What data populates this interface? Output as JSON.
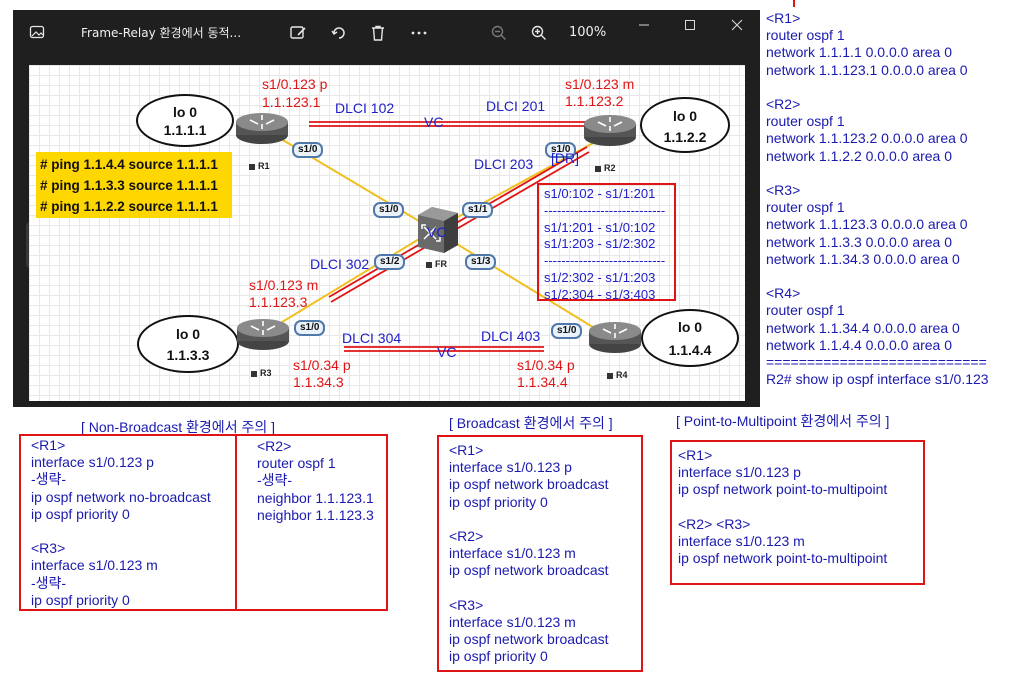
{
  "viewer": {
    "title": "Frame-Relay 환경에서 동적...",
    "zoom": "100%",
    "icons": [
      "photo-app-icon",
      "edit-image-icon",
      "rotate-icon",
      "delete-icon",
      "more-icon",
      "zoom-out-icon",
      "zoom-in-icon",
      "minimize-icon",
      "maximize-icon",
      "close-icon"
    ]
  },
  "diagram": {
    "routers": [
      {
        "name": "R1"
      },
      {
        "name": "R2"
      },
      {
        "name": "R3"
      },
      {
        "name": "R4"
      },
      {
        "name": "FR"
      }
    ],
    "loopbacks": [
      {
        "l1": "lo 0",
        "l2": "1.1.1.1"
      },
      {
        "l1": "lo 0",
        "l2": "1.1.2.2"
      },
      {
        "l1": "lo 0",
        "l2": "1.1.3.3"
      },
      {
        "l1": "lo 0",
        "l2": "1.1.4.4"
      }
    ],
    "interfaces": {
      "r1": "s1/0",
      "r2": "s1/0",
      "r3": "s1/0",
      "r4": "s1/0",
      "fr0": "s1/0",
      "fr1": "s1/1",
      "fr2": "s1/2",
      "fr3": "s1/3"
    },
    "red_labels": {
      "r1_if": "s1/0.123 p",
      "r1_ip": "1.1.123.1",
      "r2_if": "s1/0.123 m",
      "r2_ip": "1.1.123.2",
      "r3_if": "s1/0.123 m",
      "r3_ip": "1.1.123.3",
      "r3_if34": "s1/0.34 p",
      "r3_ip34": "1.1.34.3",
      "r4_if34": "s1/0.34 p",
      "r4_ip34": "1.1.34.4"
    },
    "blue_labels": {
      "dlci102": "DLCI 102",
      "dlci201": "DLCI 201",
      "dlci203": "DLCI 203",
      "dlci302": "DLCI 302",
      "dlci304": "DLCI 304",
      "dlci403": "DLCI 403",
      "vc_top": "VC",
      "vc_center": "VC",
      "vc_bottom": "VC",
      "dr": "[DR]"
    },
    "ping_lines": [
      "# ping 1.1.4.4 source 1.1.1.1",
      "# ping 1.1.3.3 source 1.1.1.1",
      "# ping 1.1.2.2 source 1.1.1.1"
    ],
    "mapping_lines": [
      "s1/0:102 - s1/1:201",
      "----------------------------",
      "s1/1:201 - s1/0:102",
      "s1/1:203 - s1/2:302",
      "----------------------------",
      "s1/2:302 - s1/1:203",
      "s1/2:304 - s1/3:403"
    ]
  },
  "right_config": [
    "<R1>",
    "router ospf 1",
    "network 1.1.1.1 0.0.0.0 area 0",
    "network 1.1.123.1 0.0.0.0 area 0",
    "",
    "<R2>",
    "router ospf 1",
    "network 1.1.123.2 0.0.0.0 area 0",
    "network 1.1.2.2 0.0.0.0 area 0",
    "",
    "<R3>",
    "router ospf 1",
    "network 1.1.123.3 0.0.0.0 area 0",
    "network 1.1.3.3 0.0.0.0 area 0",
    "network 1.1.34.3 0.0.0.0 area 0",
    "",
    "<R4>",
    "router ospf 1",
    "network 1.1.34.4 0.0.0.0 area 0",
    "network 1.1.4.4 0.0.0.0 area 0",
    "===========================",
    "R2# show ip ospf interface s1/0.123"
  ],
  "sections": {
    "non_broadcast": {
      "title": "[ Non-Broadcast 환경에서 주의 ]",
      "left_lines": [
        "<R1>",
        "interface s1/0.123 p",
        "-생략-",
        "ip ospf network no-broadcast",
        "ip ospf priority 0",
        "",
        "<R3>",
        "interface s1/0.123 m",
        "-생략-",
        "ip ospf priority 0"
      ],
      "right_lines": [
        "<R2>",
        "router ospf 1",
        "-생략-",
        "neighbor 1.1.123.1",
        "neighbor 1.1.123.3"
      ]
    },
    "broadcast": {
      "title": "[ Broadcast 환경에서 주의 ]",
      "lines": [
        "<R1>",
        "interface s1/0.123 p",
        "ip ospf network broadcast",
        "ip ospf priority 0",
        "",
        "<R2>",
        "interface s1/0.123 m",
        "ip ospf network broadcast",
        "",
        "<R3>",
        "interface s1/0.123 m",
        "ip ospf network broadcast",
        "ip ospf priority 0"
      ]
    },
    "p2mp": {
      "title": "[ Point-to-Multipoint 환경에서 주의 ]",
      "lines": [
        "<R1>",
        "interface s1/0.123 p",
        "ip ospf network point-to-multipoint",
        "",
        "<R2> <R3>",
        "interface s1/0.123 m",
        "ip ospf network point-to-multipoint"
      ]
    }
  }
}
